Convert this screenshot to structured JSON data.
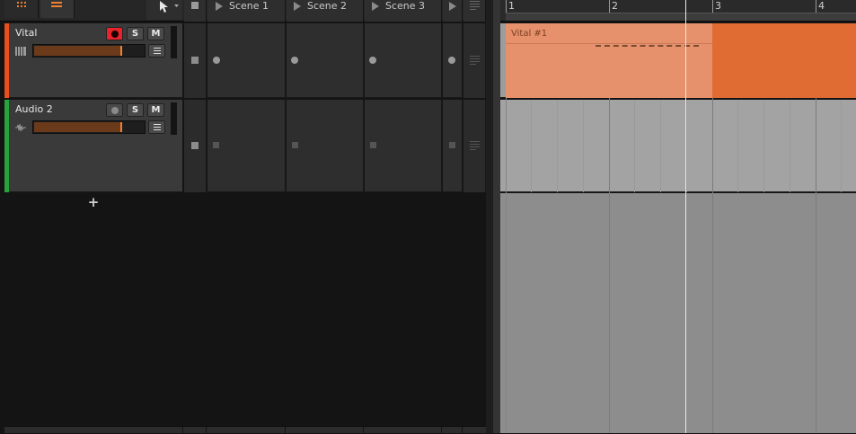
{
  "toolbar": {
    "grid_icon": "clip-launcher-icon",
    "list_icon": "arranger-icon",
    "pointer_icon": "pointer-tool-icon"
  },
  "scenes": [
    {
      "label": "Scene 1"
    },
    {
      "label": "Scene 2"
    },
    {
      "label": "Scene 3"
    }
  ],
  "tracks": [
    {
      "name": "Vital",
      "type": "instrument",
      "color": "#e8501e",
      "armed": true,
      "solo_label": "S",
      "mute_label": "M",
      "volume_fraction": 0.78
    },
    {
      "name": "Audio 2",
      "type": "audio",
      "color": "#27a33a",
      "armed": false,
      "solo_label": "S",
      "mute_label": "M",
      "volume_fraction": 0.78
    }
  ],
  "add_track_label": "+",
  "arranger": {
    "bar_numbers": [
      "1",
      "2",
      "3",
      "4"
    ],
    "clip": {
      "name": "Vital #1",
      "color": "#e6916c",
      "loop_color": "#e06c33"
    }
  },
  "colors": {
    "accent": "#f08030",
    "record": "#e8232b"
  }
}
